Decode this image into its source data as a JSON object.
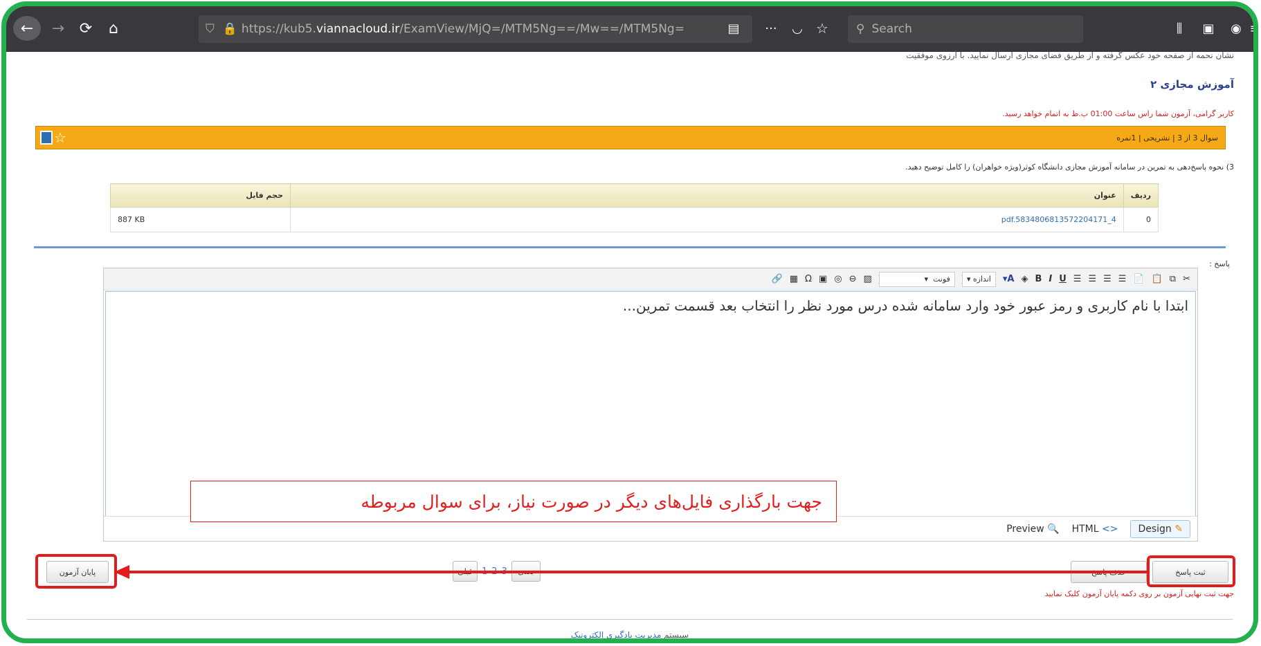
{
  "browser": {
    "url_scheme": "https://kub5.",
    "url_host": "viannacloud.ir",
    "url_path": "/ExamView/MjQ=/MTM5Ng==/Mw==/MTM5Ng=",
    "search_placeholder": "Search",
    "icons": [
      "back-arrow-icon",
      "forward-arrow-icon",
      "reload-icon",
      "home-icon",
      "shield-icon",
      "lock-icon",
      "reader-view-icon",
      "more-icon",
      "pocket-icon",
      "bookmark-star-icon",
      "library-icon",
      "sidebar-icon",
      "account-icon",
      "menu-icon"
    ]
  },
  "page": {
    "cut_line": "نشان نحمه از صفحه خود عکس گرفته و از طریق فضای مجازی ارسال نمایید. با آرزوی موفقیت",
    "title": "آموزش مجازی ۲",
    "notice_prefix": "کاربر گرامی، آزمون شما راس ساعت",
    "notice_time": "01:00",
    "notice_suffix": "ب.ظ به اتمام خواهد رسید.",
    "question_bar": "سوال 3 از 3 | تشریحی | 1نمره",
    "question_text": "3) نحوه پاسخ‌دهی به تمرین در سامانه آموزش مجازی دانشگاه کوثر(ویژه خواهران) را کامل توضیح دهید."
  },
  "files_table": {
    "headers": [
      "ردیف",
      "عنوان",
      "حجم فایل"
    ],
    "rows": [
      {
        "index": "0",
        "title": "pdf.583480681357220417‌1_4",
        "size": "887 KB"
      }
    ]
  },
  "editor": {
    "answer_label": "پاسخ :",
    "font_select": "فونت",
    "size_select": "اندازه",
    "content": "ابتدا با نام کاربری و رمز عبور خود وارد سامانه شده درس مورد نظر را انتخاب بعد قسمت تمرین...",
    "modes": {
      "design": "Design",
      "html": "HTML",
      "preview": "Preview"
    }
  },
  "annotation": {
    "text": "جهت بارگذاری فایل‌های دیگر در صورت نیاز، برای سوال مربوطه"
  },
  "actions": {
    "submit_answer": "ثبت پاسخ",
    "delete_answer": "حذف پاسخ",
    "end_exam": "پایان آزمون",
    "pages": [
      "1",
      "2",
      "3"
    ],
    "prev_label": "قبلی",
    "next_label": "بعدی",
    "final_note": "جهت ثبت نهایی آزمون بر روی دکمه پایان آزمون کلیک نمایید"
  },
  "footer": {
    "text_prefix": "سیستم",
    "text_link": "مدیریت یادگیری الکترونیک"
  },
  "colors": {
    "frame_green": "#22b14c",
    "highlight_red": "#e31b1b",
    "question_bar": "#f5a917",
    "title_blue": "#2a3f8f"
  }
}
